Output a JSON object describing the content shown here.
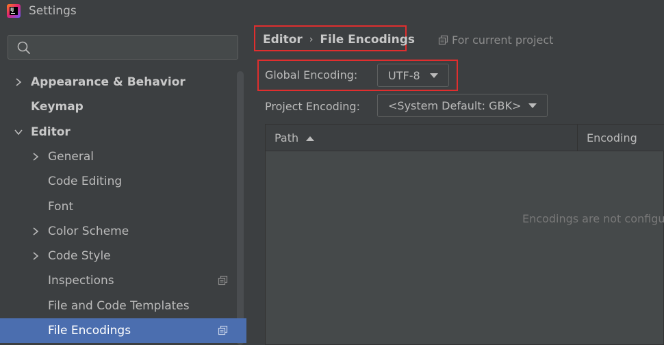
{
  "window": {
    "title": "Settings",
    "logo_text": "IJ"
  },
  "sidebar": {
    "search_placeholder": "",
    "items": [
      {
        "label": "Appearance & Behavior",
        "level": 0,
        "bold": true,
        "expandable": true,
        "expanded": false
      },
      {
        "label": "Keymap",
        "level": 0,
        "bold": true,
        "expandable": false
      },
      {
        "label": "Editor",
        "level": 0,
        "bold": true,
        "expandable": true,
        "expanded": true
      },
      {
        "label": "General",
        "level": 1,
        "expandable": true,
        "expanded": false
      },
      {
        "label": "Code Editing",
        "level": 1,
        "expandable": false
      },
      {
        "label": "Font",
        "level": 1,
        "expandable": false
      },
      {
        "label": "Color Scheme",
        "level": 1,
        "expandable": true,
        "expanded": false
      },
      {
        "label": "Code Style",
        "level": 1,
        "expandable": true,
        "expanded": false
      },
      {
        "label": "Inspections",
        "level": 1,
        "expandable": false,
        "project_icon": true
      },
      {
        "label": "File and Code Templates",
        "level": 1,
        "expandable": false
      },
      {
        "label": "File Encodings",
        "level": 1,
        "expandable": false,
        "project_icon": true,
        "selected": true
      }
    ]
  },
  "content": {
    "breadcrumb": {
      "parent": "Editor",
      "separator": "›",
      "current": "File Encodings"
    },
    "scope_note": "For current project",
    "global_encoding": {
      "label": "Global Encoding:",
      "value": "UTF-8"
    },
    "project_encoding": {
      "label": "Project Encoding:",
      "value": "<System Default: GBK>"
    },
    "table": {
      "columns": [
        "Path",
        "Encoding"
      ],
      "empty_text": "Encodings are not configu"
    }
  },
  "colors": {
    "background": "#3c3f41",
    "selection": "#4b6eaf",
    "highlight_border": "#e02e2e",
    "text": "#bbbbbb"
  }
}
